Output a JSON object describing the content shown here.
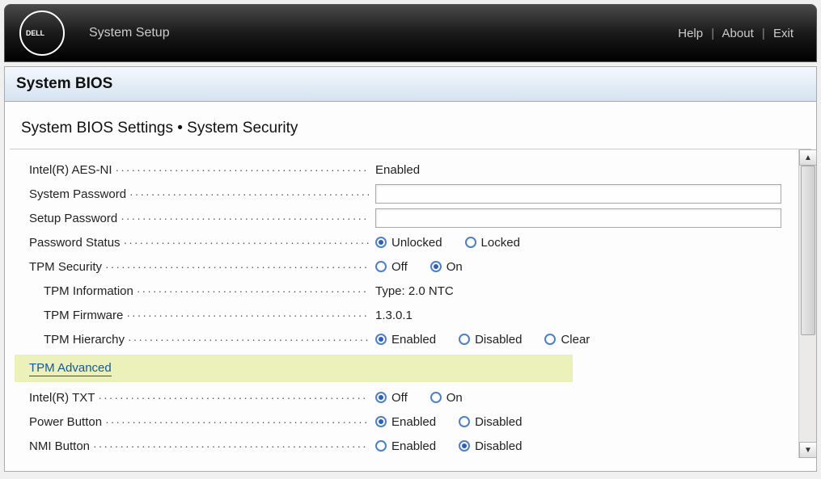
{
  "topbar": {
    "title": "System Setup",
    "links": {
      "help": "Help",
      "about": "About",
      "exit": "Exit"
    }
  },
  "section_header": "System BIOS",
  "breadcrumb": "System BIOS Settings • System Security",
  "rows": {
    "aesni": {
      "label": "Intel(R) AES-NI",
      "value": "Enabled"
    },
    "syspw": {
      "label": "System Password",
      "value": ""
    },
    "setuppw": {
      "label": "Setup Password",
      "value": ""
    },
    "pwstatus": {
      "label": "Password Status",
      "opt1": "Unlocked",
      "opt2": "Locked",
      "selected": "Unlocked"
    },
    "tpmsec": {
      "label": "TPM Security",
      "opt1": "Off",
      "opt2": "On",
      "selected": "On"
    },
    "tpminfo": {
      "label": "TPM Information",
      "value": "Type: 2.0  NTC"
    },
    "tpmfw": {
      "label": "TPM Firmware",
      "value": "1.3.0.1"
    },
    "tpmhier": {
      "label": "TPM Hierarchy",
      "opt1": "Enabled",
      "opt2": "Disabled",
      "opt3": "Clear",
      "selected": "Enabled"
    },
    "tpmadv": {
      "label": "TPM Advanced"
    },
    "txt": {
      "label": "Intel(R) TXT",
      "opt1": "Off",
      "opt2": "On",
      "selected": "Off"
    },
    "powerbtn": {
      "label": "Power Button",
      "opt1": "Enabled",
      "opt2": "Disabled",
      "selected": "Enabled"
    },
    "nmibtn": {
      "label": "NMI Button",
      "opt1": "Enabled",
      "opt2": "Disabled",
      "selected": "Disabled"
    }
  }
}
